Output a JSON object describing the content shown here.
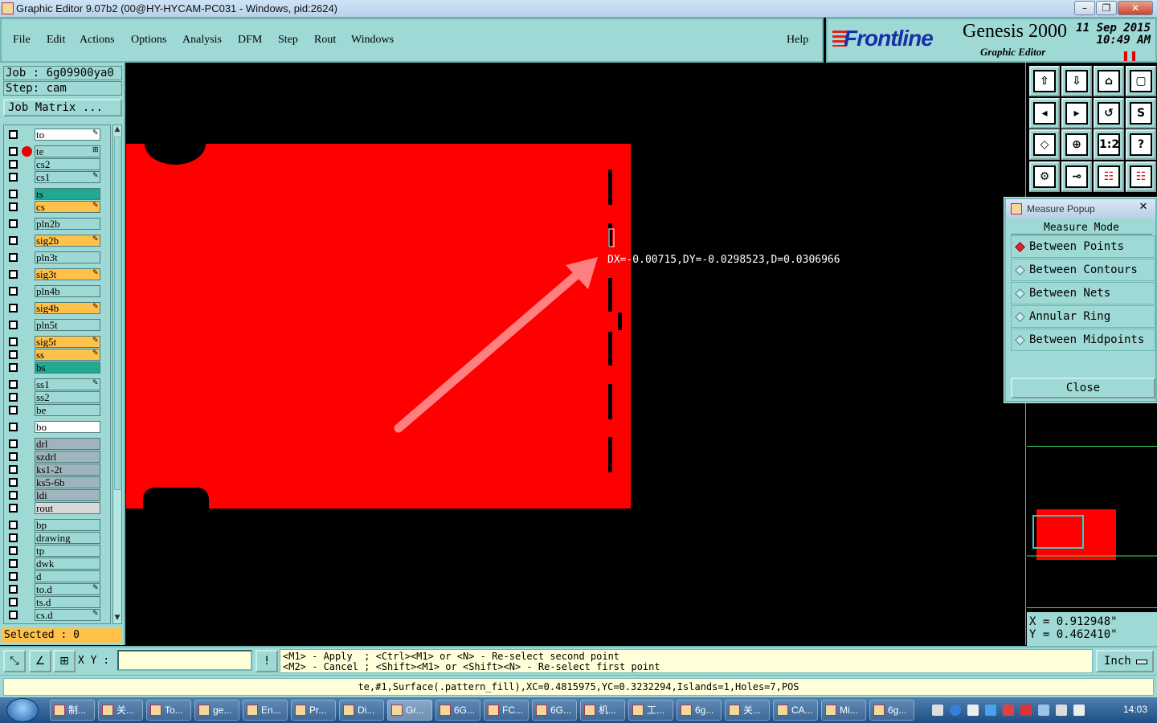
{
  "window": {
    "title": "Graphic Editor 9.07b2 (00@HY-HYCAM-PC031 - Windows, pid:2624)",
    "controls": [
      "–",
      "❐",
      "✕"
    ]
  },
  "menu": {
    "items": [
      "File",
      "Edit",
      "Actions",
      "Options",
      "Analysis",
      "DFM",
      "Step",
      "Rout",
      "Windows"
    ],
    "help": "Help"
  },
  "brand": {
    "logo": "Frontline",
    "product": "Genesis 2000",
    "subtitle": "Graphic Editor",
    "date": "11 Sep 2015",
    "time": "10:49 AM"
  },
  "job": {
    "job_label": "Job : 6g09900ya0",
    "step_label": "Step: cam",
    "matrix_button": "Job Matrix ..."
  },
  "layers": [
    {
      "name": "to",
      "color": "#ffffff",
      "mark": "✎"
    },
    {
      "name": "te",
      "color": "#9ed9d5",
      "mark": "⊞",
      "active": true
    },
    {
      "name": "cs2",
      "color": "#9ed9d5",
      "mark": ""
    },
    {
      "name": "cs1",
      "color": "#9ed9d5",
      "mark": "✎"
    },
    {
      "name": "ts",
      "color": "#20a890",
      "mark": ""
    },
    {
      "name": "cs",
      "color": "#ffc14a",
      "mark": "✎"
    },
    {
      "name": "pln2b",
      "color": "#9ed9d5",
      "mark": ""
    },
    {
      "name": "sig2b",
      "color": "#ffc14a",
      "mark": "✎"
    },
    {
      "name": "pln3t",
      "color": "#9ed9d5",
      "mark": ""
    },
    {
      "name": "sig3t",
      "color": "#ffc14a",
      "mark": "✎"
    },
    {
      "name": "pln4b",
      "color": "#9ed9d5",
      "mark": ""
    },
    {
      "name": "sig4b",
      "color": "#ffc14a",
      "mark": "✎"
    },
    {
      "name": "pln5t",
      "color": "#9ed9d5",
      "mark": ""
    },
    {
      "name": "sig5t",
      "color": "#ffc14a",
      "mark": "✎"
    },
    {
      "name": "ss",
      "color": "#ffc14a",
      "mark": "✎"
    },
    {
      "name": "bs",
      "color": "#20a890",
      "mark": ""
    },
    {
      "name": "ss1",
      "color": "#9ed9d5",
      "mark": "✎"
    },
    {
      "name": "ss2",
      "color": "#9ed9d5",
      "mark": ""
    },
    {
      "name": "be",
      "color": "#9ed9d5",
      "mark": ""
    },
    {
      "name": "bo",
      "color": "#ffffff",
      "mark": ""
    },
    {
      "name": "drl",
      "color": "#9fb4bd",
      "mark": ""
    },
    {
      "name": "szdrl",
      "color": "#9fb4bd",
      "mark": ""
    },
    {
      "name": "ks1-2t",
      "color": "#9fb4bd",
      "mark": ""
    },
    {
      "name": "ks5-6b",
      "color": "#9fb4bd",
      "mark": ""
    },
    {
      "name": "ldi",
      "color": "#9fb4bd",
      "mark": ""
    },
    {
      "name": "rout",
      "color": "#d8d8d8",
      "mark": ""
    },
    {
      "name": "bp",
      "color": "#9ed9d5",
      "mark": ""
    },
    {
      "name": "drawing",
      "color": "#9ed9d5",
      "mark": ""
    },
    {
      "name": "tp",
      "color": "#9ed9d5",
      "mark": ""
    },
    {
      "name": "dwk",
      "color": "#9ed9d5",
      "mark": ""
    },
    {
      "name": "d",
      "color": "#9ed9d5",
      "mark": ""
    },
    {
      "name": "to.d",
      "color": "#9ed9d5",
      "mark": "✎"
    },
    {
      "name": "ts.d",
      "color": "#9ed9d5",
      "mark": ""
    },
    {
      "name": "cs.d",
      "color": "#9ed9d5",
      "mark": "✎"
    }
  ],
  "selected_label": "Selected : 0",
  "measure_readout": "DX=-0.00715,DY=-0.0298523,D=0.0306966",
  "measure_popup": {
    "title": "Measure Popup",
    "close_x": "✕",
    "heading": "Measure Mode",
    "options": [
      {
        "label": "Between Points",
        "selected": true
      },
      {
        "label": "Between Contours",
        "selected": false
      },
      {
        "label": "Between Nets",
        "selected": false
      },
      {
        "label": "Annular Ring",
        "selected": false
      },
      {
        "label": "Between Midpoints",
        "selected": false
      }
    ],
    "close_button": "Close"
  },
  "tools": [
    {
      "name": "load-icon",
      "glyph": "⇧"
    },
    {
      "name": "save-icon",
      "glyph": "⇩"
    },
    {
      "name": "home-icon",
      "glyph": "⌂"
    },
    {
      "name": "window-icon",
      "glyph": "▢"
    },
    {
      "name": "pan-left-icon",
      "glyph": "◂"
    },
    {
      "name": "pan-right-icon",
      "glyph": "▸"
    },
    {
      "name": "undo-icon",
      "glyph": "↺"
    },
    {
      "name": "snap-icon",
      "glyph": "S"
    },
    {
      "name": "zoom-fit-icon",
      "glyph": "◇"
    },
    {
      "name": "zoom-home-icon",
      "glyph": "⊕"
    },
    {
      "name": "ratio-icon",
      "glyph": "1:2"
    },
    {
      "name": "help-icon",
      "glyph": "?"
    },
    {
      "name": "settings-icon",
      "glyph": "⚙"
    },
    {
      "name": "measure-icon",
      "glyph": "⊸"
    },
    {
      "name": "layers-on-icon",
      "glyph": "☷"
    },
    {
      "name": "layers-off-icon",
      "glyph": "☷"
    }
  ],
  "coords": {
    "x": "X = 0.912948\"",
    "y": "Y = 0.462410\""
  },
  "bottom": {
    "xy_label": "X Y :",
    "xy_value": "",
    "bang": "!",
    "prompt_line1": "<M1> - Apply  ; <Ctrl><M1> or <N> - Re-select second point",
    "prompt_line2": "<M2> - Cancel ; <Shift><M1> or <Shift><N> - Re-select first point",
    "unit": "Inch"
  },
  "status": "te,#1,Surface(.pattern_fill),XC=0.4815975,YC=0.3232294,Islands=1,Holes=7,POS",
  "taskbar": {
    "tasks": [
      "制...",
      "关...",
      "To...",
      "ge...",
      "En...",
      "Pr...",
      "Di...",
      "Gr...",
      "6G...",
      "FC...",
      "6G...",
      "机...",
      "工...",
      "6g...",
      "关...",
      "CA...",
      "Mi...",
      "6g..."
    ],
    "active_index": 7,
    "clock": "14:03"
  },
  "colors": {
    "board": "#ff0000",
    "highlight_arrow": "#ff8080",
    "readout": "#ffffff",
    "panel": "#9ed9d5"
  }
}
